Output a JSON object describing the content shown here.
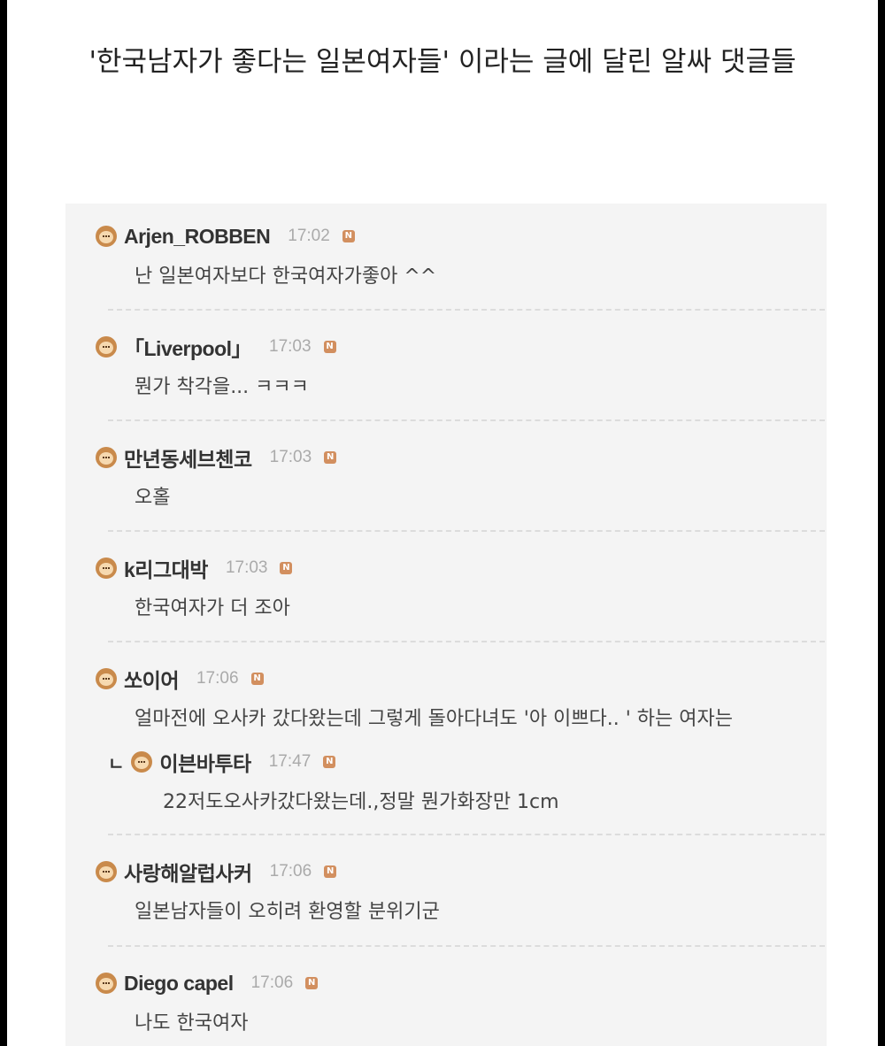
{
  "post": {
    "title": "'한국남자가 좋다는 일본여자들' 이라는 글에 달린 알싸 댓글들"
  },
  "badge_label": "N",
  "reply_marker": "ㄴ",
  "comments": [
    {
      "nick": "Arjen_ROBBEN",
      "time": "17:02",
      "text": "난 일본여자보다 한국여자가좋아 ^^"
    },
    {
      "nick": "「Liverpool」",
      "time": "17:03",
      "text": "뭔가 착각을... ㅋㅋㅋ"
    },
    {
      "nick": "만년동세브첸코",
      "time": "17:03",
      "text": "오홀"
    },
    {
      "nick": "k리그대박",
      "time": "17:03",
      "text": "한국여자가 더 조아"
    },
    {
      "nick": "쏘이어",
      "time": "17:06",
      "text": "얼마전에 오사카 갔다왔는데 그렇게 돌아다녀도 '아 이쁘다.. ' 하는 여자는"
    },
    {
      "nick": "이븐바투타",
      "time": "17:47",
      "text": "22저도오사카갔다왔는데.,정말 뭔가화장만 1cm"
    },
    {
      "nick": "사랑해알럽사커",
      "time": "17:06",
      "text": "일본남자들이 오히려 환영할 분위기군"
    },
    {
      "nick": "Diego capel",
      "time": "17:06",
      "text": "나도 한국여자"
    }
  ],
  "colors": {
    "background": "#000000",
    "page": "#ffffff",
    "comment_area": "#f4f4f4",
    "badge": "#d28f5f",
    "time": "#aaaaaa"
  },
  "icons": {
    "avatar": "face-icon",
    "badge": "new-badge-icon"
  }
}
